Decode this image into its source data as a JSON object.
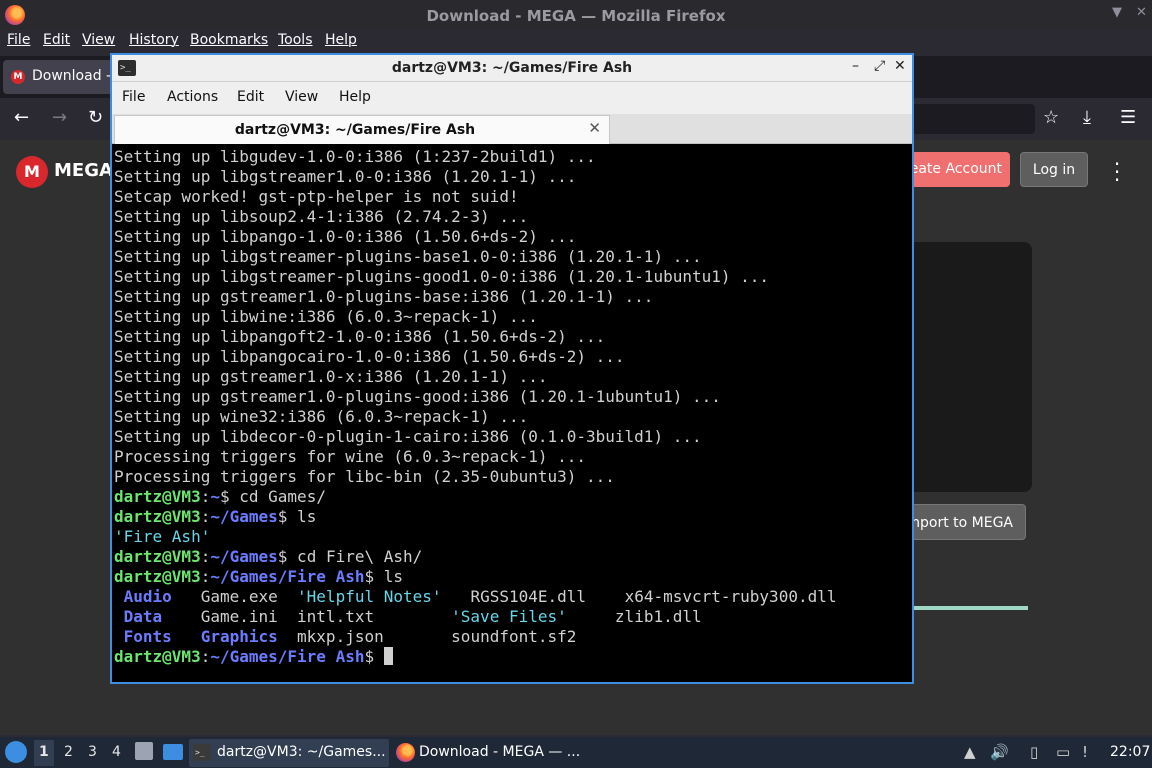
{
  "firefox": {
    "window_title": "Download - MEGA — Mozilla Firefox",
    "menu": [
      "File",
      "Edit",
      "View",
      "History",
      "Bookmarks",
      "Tools",
      "Help"
    ],
    "tab_label": "Download -",
    "favicon_letter": "M"
  },
  "mega": {
    "logo_letter": "M",
    "wordmark": "MEGA",
    "create_account": "eate Account",
    "login": "Log in",
    "import": "mport to MEGA",
    "progress_fraction": 1.0
  },
  "terminal": {
    "title": "dartz@VM3: ~/Games/Fire Ash",
    "icon_glyph": ">_",
    "menu": [
      "File",
      "Actions",
      "Edit",
      "View",
      "Help"
    ],
    "tab_label": "dartz@VM3: ~/Games/Fire Ash",
    "output_lines": [
      "Setting up libgudev-1.0-0:i386 (1:237-2build1) ...",
      "Setting up libgstreamer1.0-0:i386 (1.20.1-1) ...",
      "Setcap worked! gst-ptp-helper is not suid!",
      "Setting up libsoup2.4-1:i386 (2.74.2-3) ...",
      "Setting up libpango-1.0-0:i386 (1.50.6+ds-2) ...",
      "Setting up libgstreamer-plugins-base1.0-0:i386 (1.20.1-1) ...",
      "Setting up libgstreamer-plugins-good1.0-0:i386 (1.20.1-1ubuntu1) ...",
      "Setting up gstreamer1.0-plugins-base:i386 (1.20.1-1) ...",
      "Setting up libwine:i386 (6.0.3~repack-1) ...",
      "Setting up libpangoft2-1.0-0:i386 (1.50.6+ds-2) ...",
      "Setting up libpangocairo-1.0-0:i386 (1.50.6+ds-2) ...",
      "Setting up gstreamer1.0-x:i386 (1.20.1-1) ...",
      "Setting up gstreamer1.0-plugins-good:i386 (1.20.1-1ubuntu1) ...",
      "Setting up wine32:i386 (6.0.3~repack-1) ...",
      "Setting up libdecor-0-plugin-1-cairo:i386 (0.1.0-3build1) ...",
      "Processing triggers for wine (6.0.3~repack-1) ...",
      "Processing triggers for libc-bin (2.35-0ubuntu3) ..."
    ],
    "prompt_user": "dartz@VM3",
    "prompts": [
      {
        "path": "~",
        "cmd": " cd Games/"
      },
      {
        "path": "~/Games",
        "cmd": " ls"
      },
      {
        "path": "~/Games",
        "cmd": " cd Fire\\ Ash/"
      },
      {
        "path": "~/Games/Fire Ash",
        "cmd": " ls"
      }
    ],
    "ls_games_output": "'Fire Ash'",
    "ls_fireash_rows": [
      [
        " Audio",
        "   ",
        "Game.exe",
        "  ",
        "'Helpful Notes'",
        "   ",
        "RGSS104E.dll",
        "    ",
        "x64-msvcrt-ruby300.dll"
      ],
      [
        " Data",
        "    ",
        "Game.ini",
        "  ",
        "intl.txt",
        "        ",
        "'Save Files'",
        "     ",
        "zlib1.dll"
      ],
      [
        " Fonts",
        "   ",
        "Graphics",
        "  ",
        "mkxp.json",
        "       ",
        "soundfont.sf2",
        "",
        ""
      ]
    ],
    "final_prompt_path": "~/Games/Fire Ash"
  },
  "taskbar": {
    "workspaces": [
      "1",
      "2",
      "3",
      "4"
    ],
    "active_workspace": "1",
    "term_task": "dartz@VM3: ~/Games...",
    "term_task_icon": ">_",
    "ff_task": "Download - MEGA — ...",
    "clock": "22:07"
  },
  "colors": {
    "prompt_green": "#6ee56e",
    "dir_blue": "#6b7cff",
    "terminal_border": "#3d8ee0",
    "mega_red": "#d9272e"
  }
}
